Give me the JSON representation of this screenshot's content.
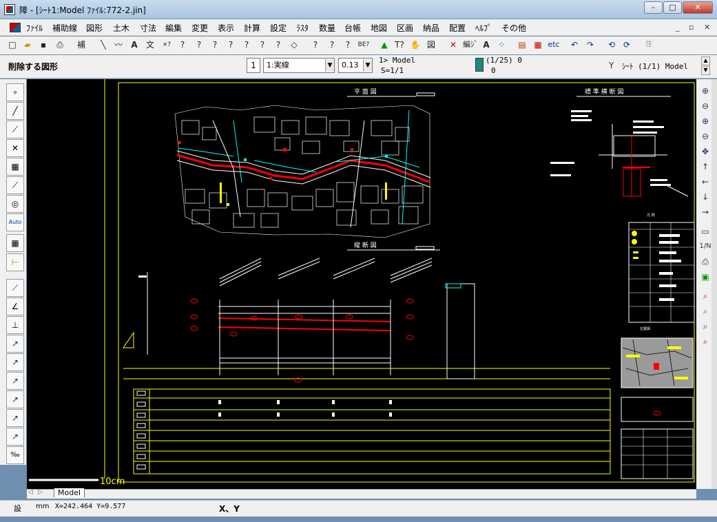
{
  "window": {
    "title": "障 - [ｼｰﾄ1:Model  ﾌｧｲﾙ:772-2.jin]"
  },
  "menu": [
    "ﾌｧｲﾙ",
    "補助線",
    "図形",
    "土木",
    "寸法",
    "編集",
    "変更",
    "表示",
    "計算",
    "設定",
    "ﾗｽﾀ",
    "数量",
    "台帳",
    "地図",
    "区画",
    "納品",
    "配置",
    "ﾍﾙﾌﾟ",
    "その他"
  ],
  "toolbar": {
    "hojo": "補",
    "text": "文",
    "etc": "etc",
    "edit": "編ｼﾞ"
  },
  "prop": {
    "mode": "削除する図形",
    "layer": "1",
    "linetype": "1:実線",
    "width": "0.13",
    "model": "1> Model",
    "scale": "S=1/1",
    "color_info": "(1/25) 0",
    "color_sub": "0",
    "sheet": "ｼｰﾄ (1/1) Model"
  },
  "drawing": {
    "plan_title": "平 面 図",
    "cross_title": "標 準 横 断 図",
    "long_title": "縦 断 図",
    "legend_title": "凡 例",
    "location_title": "位置図",
    "scalebar": "10cm"
  },
  "tabs": {
    "model": "Model"
  },
  "status": {
    "mode": "設",
    "unit": "mm",
    "coords": "X=242.464 Y=9.577",
    "prompt": "X、Y"
  }
}
